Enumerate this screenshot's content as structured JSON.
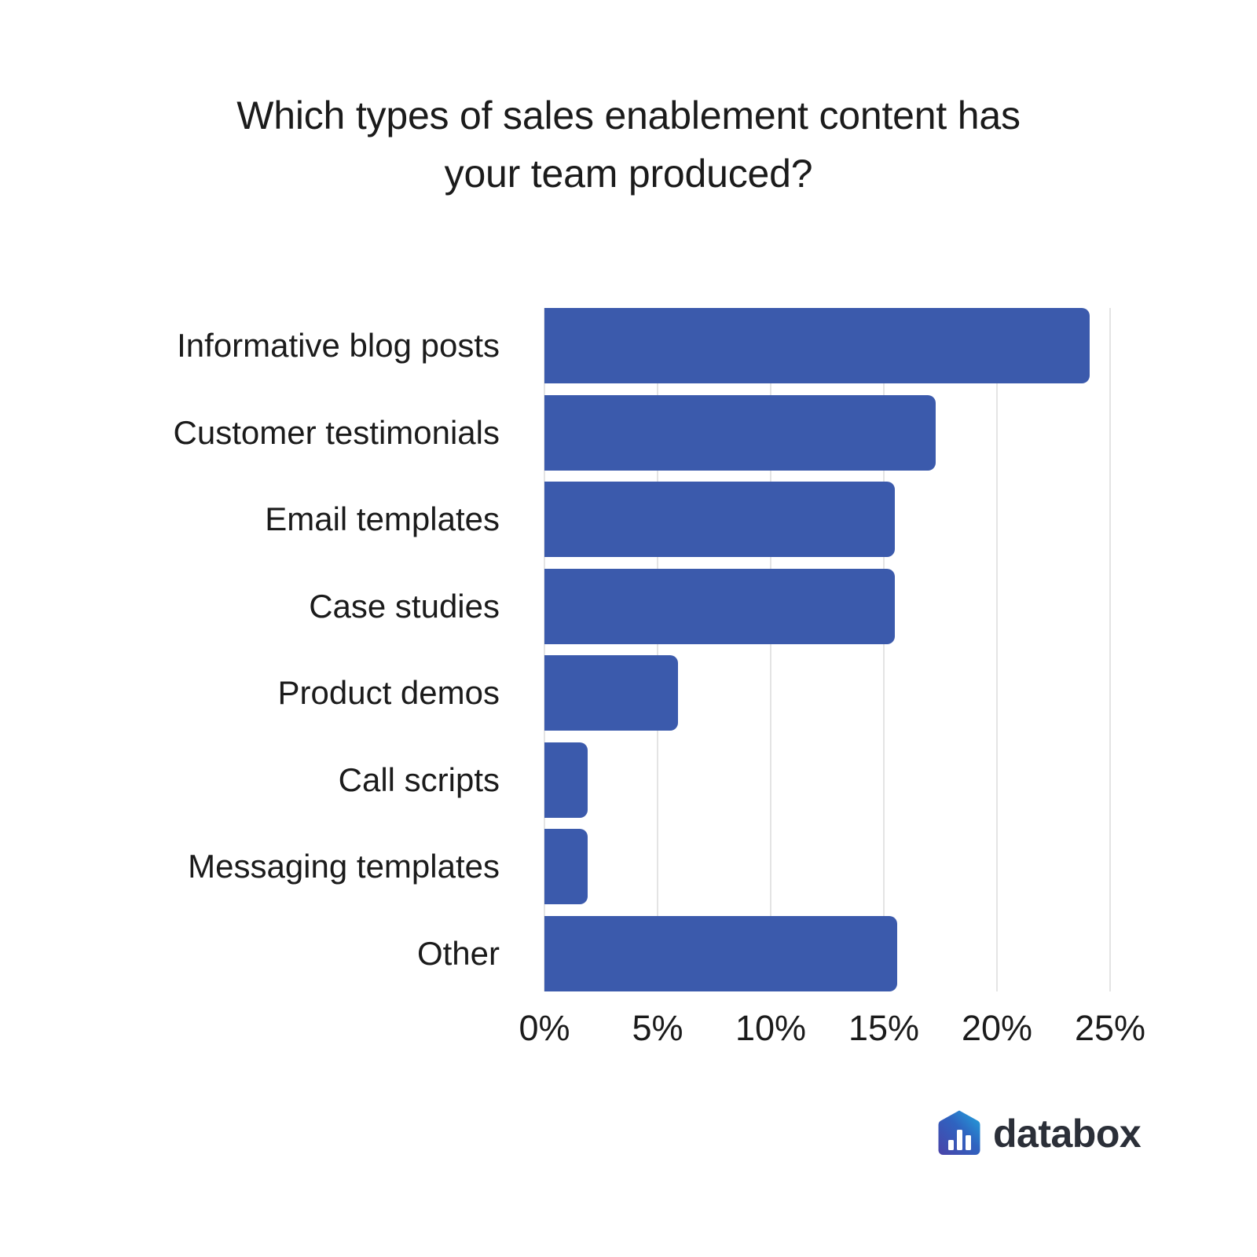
{
  "chart_data": {
    "type": "bar",
    "orientation": "horizontal",
    "title": "Which types of sales enablement content has\nyour team produced?",
    "xlabel": "",
    "ylabel": "",
    "categories": [
      "Informative blog posts",
      "Customer testimonials",
      "Email templates",
      "Case studies",
      "Product demos",
      "Call scripts",
      "Messaging templates",
      "Other"
    ],
    "values": [
      24.1,
      17.3,
      15.5,
      15.5,
      5.9,
      1.9,
      1.9,
      15.6
    ],
    "xlim": [
      0,
      25
    ],
    "xticks": [
      0,
      5,
      10,
      15,
      20,
      25
    ],
    "xtick_labels": [
      "0%",
      "5%",
      "10%",
      "15%",
      "20%",
      "25%"
    ],
    "grid": true,
    "grid_axis": "x",
    "legend": false,
    "bar_color": "#3b5aac",
    "gridline_color": "#e4e4e4",
    "background_color": "#ffffff",
    "text_color": "#1b1b1b"
  },
  "branding": {
    "wordmark": "databox",
    "mark_icon": "databox-hexagon-bars-icon",
    "mark_gradient_from": "#4a43a8",
    "mark_gradient_to": "#22a7dd",
    "wordmark_color": "#2b2f38"
  }
}
